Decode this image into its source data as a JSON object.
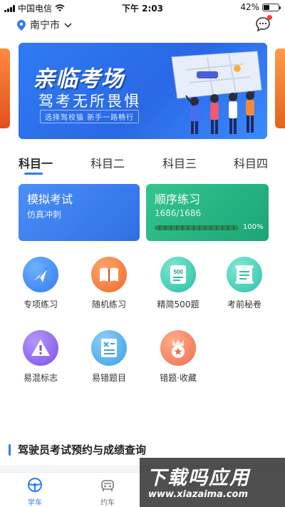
{
  "status_bar": {
    "carrier": "中国电信",
    "time": "下午 2:03",
    "battery": "42%",
    "battery_level": 0.42
  },
  "header": {
    "city": "南宁市"
  },
  "banner": {
    "title": "亲临考场",
    "subtitle": "驾考无所畏惧",
    "note": "选择驾校猫 新手一路畅行"
  },
  "tabs": [
    "科目一",
    "科目二",
    "科目三",
    "科目四"
  ],
  "active_tab": 0,
  "cards": {
    "exam": {
      "title": "模拟考试",
      "desc": "仿真冲刺"
    },
    "sequence": {
      "title": "顺序练习",
      "progress_text": "1686/1686",
      "progress_pct": "100%",
      "progress": 1.0
    }
  },
  "grid": [
    {
      "label": "专项练习",
      "icon": "arrow-icon",
      "color": "#3a8ff5"
    },
    {
      "label": "随机练习",
      "icon": "book-icon",
      "color": "#f07a3a"
    },
    {
      "label": "精简500题",
      "icon": "list-500-icon",
      "color": "#2cc3a8"
    },
    {
      "label": "考前秘卷",
      "icon": "scroll-icon",
      "color": "#2cc3a8"
    },
    {
      "label": "易混标志",
      "icon": "warning-sign-icon",
      "color": "#8c65e6"
    },
    {
      "label": "易错题目",
      "icon": "error-sheet-icon",
      "color": "#3aa0e6"
    },
    {
      "label": "错题·收藏",
      "icon": "star-badge-icon",
      "color": "#f07a55"
    }
  ],
  "section": {
    "title": "驾驶员考试预约与成绩查询"
  },
  "nav": [
    {
      "label": "学车",
      "icon": "steering-wheel-icon"
    },
    {
      "label": "约车",
      "icon": "car-icon"
    }
  ],
  "watermark": {
    "main": "下载吗应用",
    "url": "www.xiazaima.com"
  }
}
